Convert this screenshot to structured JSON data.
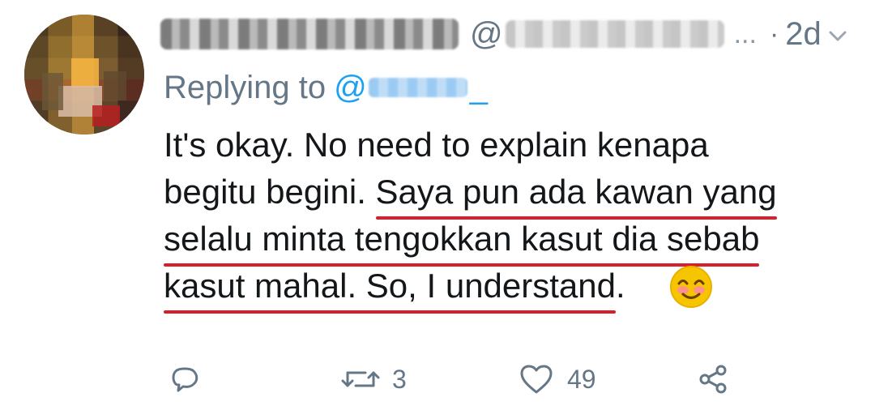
{
  "tweet": {
    "handle_prefix": "@",
    "handle_ellipsis": "...",
    "separator": "·",
    "time": "2d",
    "replying_label": "Replying to",
    "replying_at": "@",
    "replying_tail": "_",
    "body": {
      "line1": "It's okay. No need to explain kenapa",
      "line2_plain": "begitu begini. ",
      "line2_underlined": "Saya pun ada kawan yang",
      "line3_underlined": "selalu minta tengokkan kasut dia sebab",
      "line4_underlined": "kasut mahal. So, I understand",
      "line4_tail": "."
    },
    "actions": {
      "reply_count": "",
      "retweet_count": "3",
      "like_count": "49",
      "share_count": ""
    }
  },
  "icons": {
    "menu": "chevron-down-icon",
    "reply": "reply-icon",
    "retweet": "retweet-icon",
    "like": "heart-icon",
    "share": "share-icon",
    "emoji": "smiling-face-icon"
  },
  "colors": {
    "text": "#14171a",
    "secondary": "#657786",
    "link": "#1da1f2",
    "underline": "#d81f2b",
    "emoji": "#f7c400"
  }
}
